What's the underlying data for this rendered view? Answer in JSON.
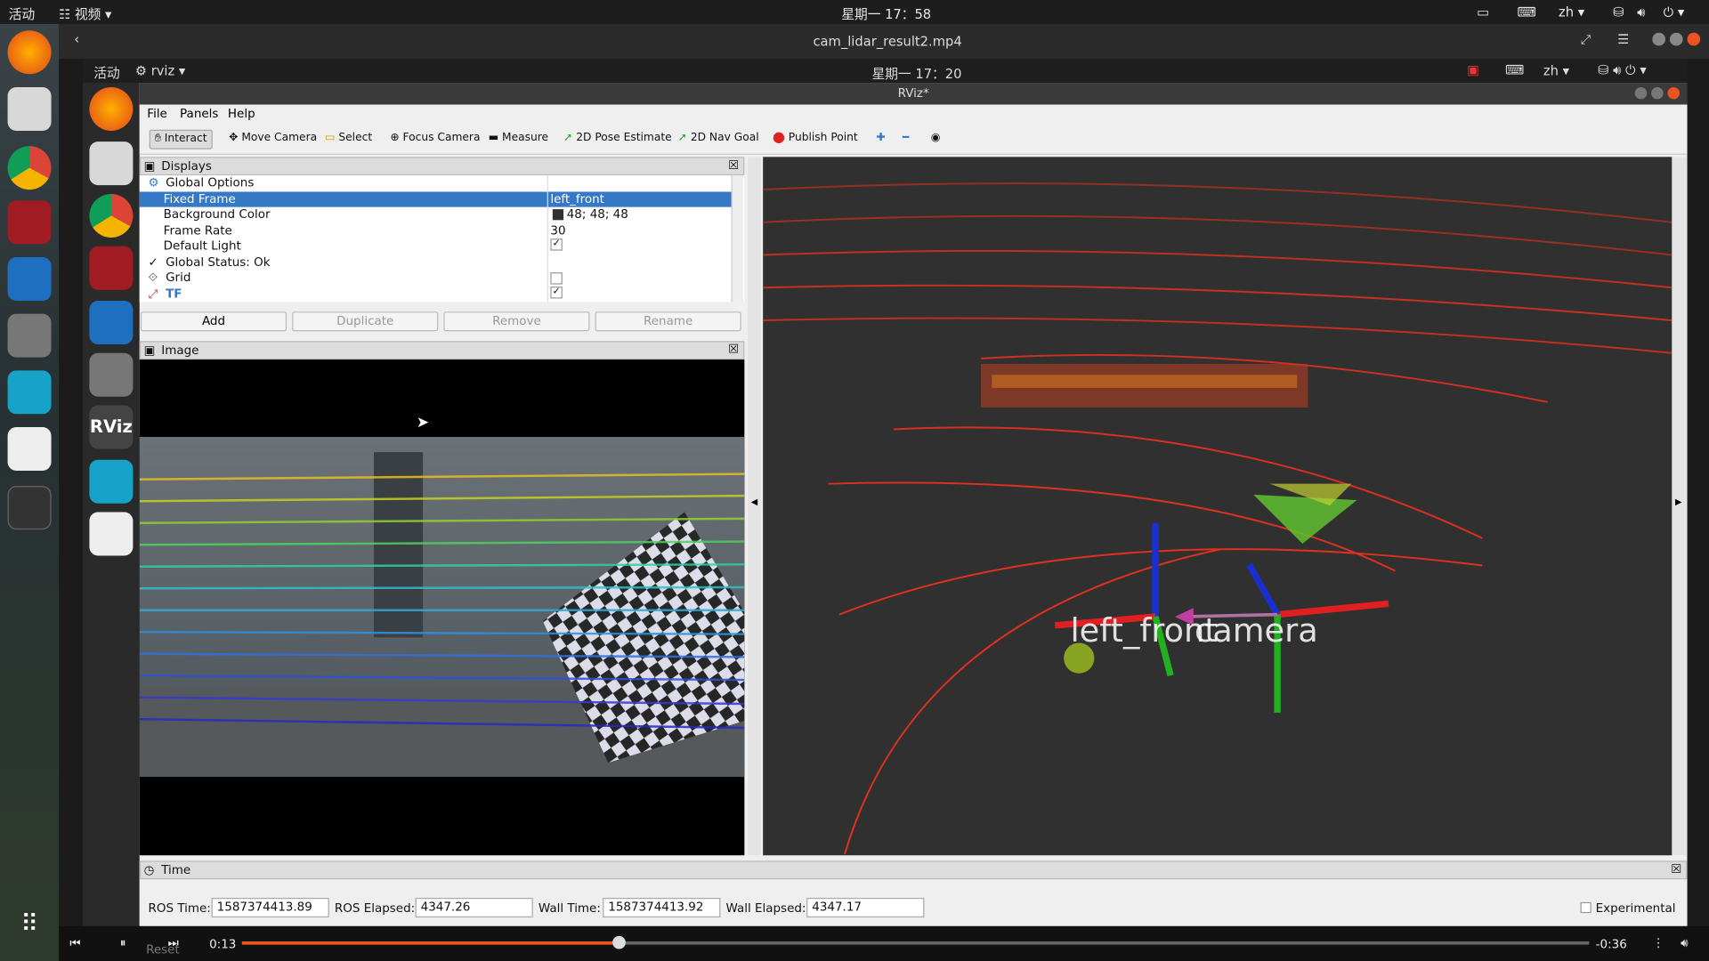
{
  "system": {
    "activities": "活动",
    "app_menu": "视频",
    "clock": "星期一 17：58",
    "lang": "zh"
  },
  "player": {
    "title": "cam_lidar_result2.mp4",
    "time_current": "0:13",
    "time_remaining": "-0:36",
    "progress": 0.28
  },
  "inner_system": {
    "activities": "活动",
    "app_menu": "rviz",
    "clock": "星期一 17：20",
    "lang": "zh"
  },
  "rviz": {
    "window_title": "RViz*",
    "menu": [
      "File",
      "Panels",
      "Help"
    ],
    "tools": [
      "Interact",
      "Move Camera",
      "Select",
      "Focus Camera",
      "Measure",
      "2D Pose Estimate",
      "2D Nav Goal",
      "Publish Point"
    ],
    "displays": {
      "title": "Displays",
      "rows": [
        {
          "label": "Global Options",
          "value": ""
        },
        {
          "label": "Fixed Frame",
          "value": "left_front"
        },
        {
          "label": "Background Color",
          "value": "48; 48; 48"
        },
        {
          "label": "Frame Rate",
          "value": "30"
        },
        {
          "label": "Default Light",
          "value": "✓"
        },
        {
          "label": "Global Status: Ok",
          "value": ""
        },
        {
          "label": "Grid",
          "value": ""
        },
        {
          "label": "TF",
          "value": "✓"
        }
      ],
      "buttons": [
        "Add",
        "Duplicate",
        "Remove",
        "Rename"
      ]
    },
    "image_panel_title": "Image",
    "view_labels": {
      "frame_a": "left_front",
      "frame_b": "camera"
    },
    "time": {
      "title": "Time",
      "ros_time_label": "ROS Time:",
      "ros_time": "1587374413.89",
      "ros_elapsed_label": "ROS Elapsed:",
      "ros_elapsed": "4347.26",
      "wall_time_label": "Wall Time:",
      "wall_time": "1587374413.92",
      "wall_elapsed_label": "Wall Elapsed:",
      "wall_elapsed": "4347.17",
      "experimental": "Experimental",
      "reset": "Reset"
    }
  },
  "colors": {
    "accent": "#3478c6",
    "bg3d": "#303030",
    "progress": "#e95420"
  }
}
